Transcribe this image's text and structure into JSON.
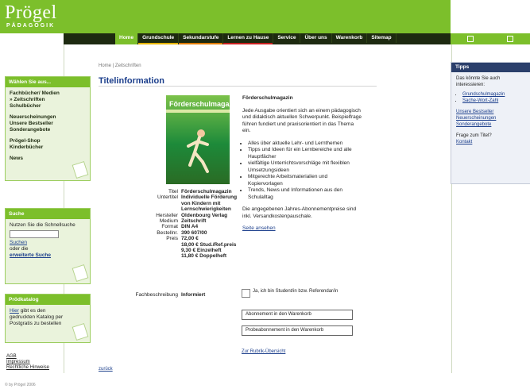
{
  "brand": {
    "name": "Prögel",
    "subtitle": "PÄDAGOGIK"
  },
  "nav": [
    {
      "label": "Home",
      "active": true,
      "color": "#7cbf2b"
    },
    {
      "label": "Grundschule",
      "active": false,
      "color": "#e6b400"
    },
    {
      "label": "Sekundarstufe",
      "active": false,
      "color": "#e07b00"
    },
    {
      "label": "Lernen zu Hause",
      "active": false,
      "color": "#c82020"
    },
    {
      "label": "Service",
      "active": false,
      "color": ""
    },
    {
      "label": "Über uns",
      "active": false,
      "color": ""
    },
    {
      "label": "Warenkorb",
      "active": false,
      "color": ""
    },
    {
      "label": "Sitemap",
      "active": false,
      "color": ""
    }
  ],
  "sidebar": {
    "select": {
      "title": "Wählen Sie aus...",
      "groups": [
        [
          "Fachbücher/ Medien",
          "» Zeitschriften",
          "Schulbücher"
        ],
        [
          "Neuerscheinungen",
          "Unsere Bestseller",
          "Sonderangebote"
        ],
        [
          "Prögel-Shop",
          "Kinderbücher"
        ],
        [
          "News"
        ]
      ]
    },
    "search": {
      "title": "Suche",
      "text": "Nutzen Sie die Schnellsuche",
      "button": "Suchen",
      "or": "oder die",
      "advanced": "erweiterte Suche"
    },
    "catalog": {
      "title": "Prödkatalog",
      "link": "Hier",
      "text": "gibt es den gedruckten Katalog per Postgratis zu bestellen"
    },
    "footer_links": [
      "AGB",
      "Impressum",
      "Rechtliche Hinweise"
    ],
    "copyright": "© by Prögel 2006"
  },
  "main": {
    "breadcrumb": "Home | Zeitschriften",
    "title": "Titelinformation",
    "cover": {
      "title": "Förderschulmagazin"
    },
    "details": [
      {
        "label": "Titel",
        "value": "Förderschulmagazin"
      },
      {
        "label": "Untertitel",
        "value": "Individuelle Förderung"
      },
      {
        "label": "",
        "value": "von Kindern mit"
      },
      {
        "label": "",
        "value": "Lernschwierigkeiten"
      },
      {
        "label": "Hersteller",
        "value": "Oldenbourg Verlag"
      },
      {
        "label": "Medium",
        "value": "Zeitschrift"
      },
      {
        "label": "Format",
        "value": "DIN A4"
      },
      {
        "label": "Bestellnr.",
        "value": "390 607/00"
      },
      {
        "label": "Preis",
        "value": "72,00 €"
      },
      {
        "label": "",
        "value": "18,00 € Stud./Ref.preis"
      },
      {
        "label": "",
        "value": "9,30 € Einzelheft"
      },
      {
        "label": "",
        "value": "11,80 € Doppelheft"
      }
    ],
    "fach": {
      "label": "Fachbeschreibung",
      "value": "Informiert"
    },
    "description": {
      "title": "Förderschulmagazin",
      "intro": "Jede Ausgabe orientiert sich an einem pädagogisch und didaktisch aktuellen Schwerpunkt. Beispielfrage führen fundiert und praxisorientiert in das Thema ein.",
      "bullets": [
        "Alles über aktuelle Lehr- und Lernthemen",
        "Tipps und Ideen für ein Lernbereiche und alle Hauptfächer",
        "vielfältige Unterrichtsvorschläge mit flexiblen Umsetzungsideen",
        "Mitgerechte Arbeitsmaterialien und Kopiervorlagen",
        "Trends, News und Informationen aus den Schulalltag"
      ],
      "note": "Die angegebenen Jahres-Abonnementpreise sind inkl. Versandkostenpauschale.",
      "sample_link": "Seite ansehen"
    },
    "checkbox_label": "Ja, ich bin Student/in bzw. Referendar/in",
    "buttons": [
      "Abonnement in den Warenkorb",
      "Probeabonnement in den Warenkorb"
    ],
    "overview_link": "Zur Rubrik-Übersicht",
    "back_link": "zurück"
  },
  "tipps": {
    "title": "Tipps",
    "text": "Das könnte Sie auch interessieren:",
    "links": [
      "Grundschulmagazin",
      "Sache-Wort-Zahl"
    ],
    "links2": [
      "Unsere Bestseller",
      "Neuerscheinungen",
      "Sonderangebote"
    ],
    "question": "Frage zum Titel?",
    "contact": "Kontakt"
  }
}
